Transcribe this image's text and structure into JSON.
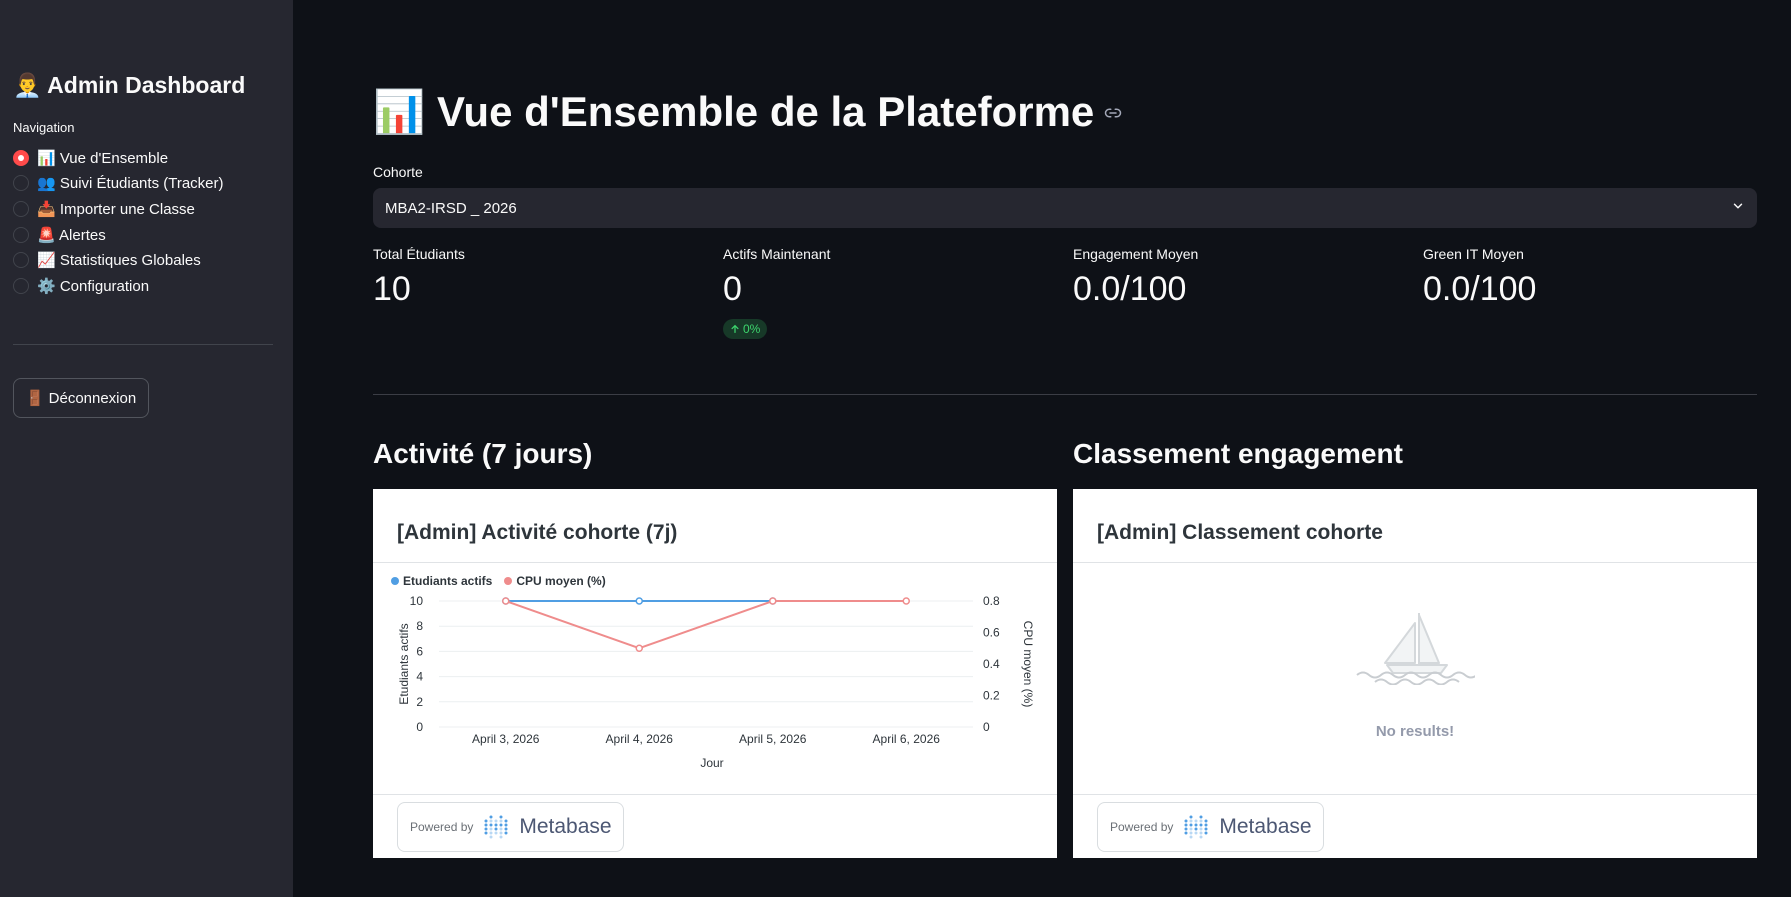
{
  "sidebar": {
    "title": "👨‍💼 Admin Dashboard",
    "nav_label": "Navigation",
    "items": [
      {
        "label": "📊 Vue d'Ensemble",
        "checked": true
      },
      {
        "label": "👥 Suivi Étudiants (Tracker)",
        "checked": false
      },
      {
        "label": "📥 Importer une Classe",
        "checked": false
      },
      {
        "label": "🚨 Alertes",
        "checked": false
      },
      {
        "label": "📈 Statistiques Globales",
        "checked": false
      },
      {
        "label": "⚙️ Configuration",
        "checked": false
      }
    ],
    "logout_label": "🚪 Déconnexion"
  },
  "main": {
    "title": "📊 Vue d'Ensemble de la Plateforme",
    "cohort_label": "Cohorte",
    "cohort_value": "MBA2-IRSD _ 2026",
    "metrics": [
      {
        "label": "Total Étudiants",
        "value": "10"
      },
      {
        "label": "Actifs Maintenant",
        "value": "0",
        "delta": "0%"
      },
      {
        "label": "Engagement Moyen",
        "value": "0.0/100"
      },
      {
        "label": "Green IT Moyen",
        "value": "0.0/100"
      }
    ],
    "activity_section": "Activité (7 jours)",
    "ranking_section": "Classement engagement"
  },
  "activity_card": {
    "title": "[Admin] Activité cohorte (7j)",
    "powered_by": "Powered by",
    "brand": "Metabase"
  },
  "ranking_card": {
    "title": "[Admin] Classement cohorte",
    "empty_text": "No results!",
    "powered_by": "Powered by",
    "brand": "Metabase"
  },
  "colors": {
    "accent": "#ff4b4b",
    "series_blue": "#509ee3",
    "series_red": "#ef8c8c"
  },
  "chart_data": {
    "type": "line",
    "title": "[Admin] Activité cohorte (7j)",
    "x": [
      "April 3, 2026",
      "April 4, 2026",
      "April 5, 2026",
      "April 6, 2026"
    ],
    "xlabel": "Jour",
    "ylabel_left": "Etudiants actifs",
    "ylabel_right": "CPU moyen (%)",
    "yleft_ticks": [
      "0",
      "2",
      "4",
      "6",
      "8",
      "10"
    ],
    "yright_ticks": [
      "0",
      "0.2",
      "0.4",
      "0.6",
      "0.8"
    ],
    "ylim_left": [
      0,
      10
    ],
    "ylim_right": [
      0,
      0.8
    ],
    "series": [
      {
        "name": "Etudiants actifs",
        "axis": "left",
        "color": "#509ee3",
        "values": [
          10,
          10,
          10,
          null
        ]
      },
      {
        "name": "CPU moyen (%)",
        "axis": "right",
        "color": "#ef8c8c",
        "values": [
          0.8,
          0.5,
          0.8,
          0.8
        ]
      }
    ],
    "legend": "top-left",
    "grid": true
  }
}
